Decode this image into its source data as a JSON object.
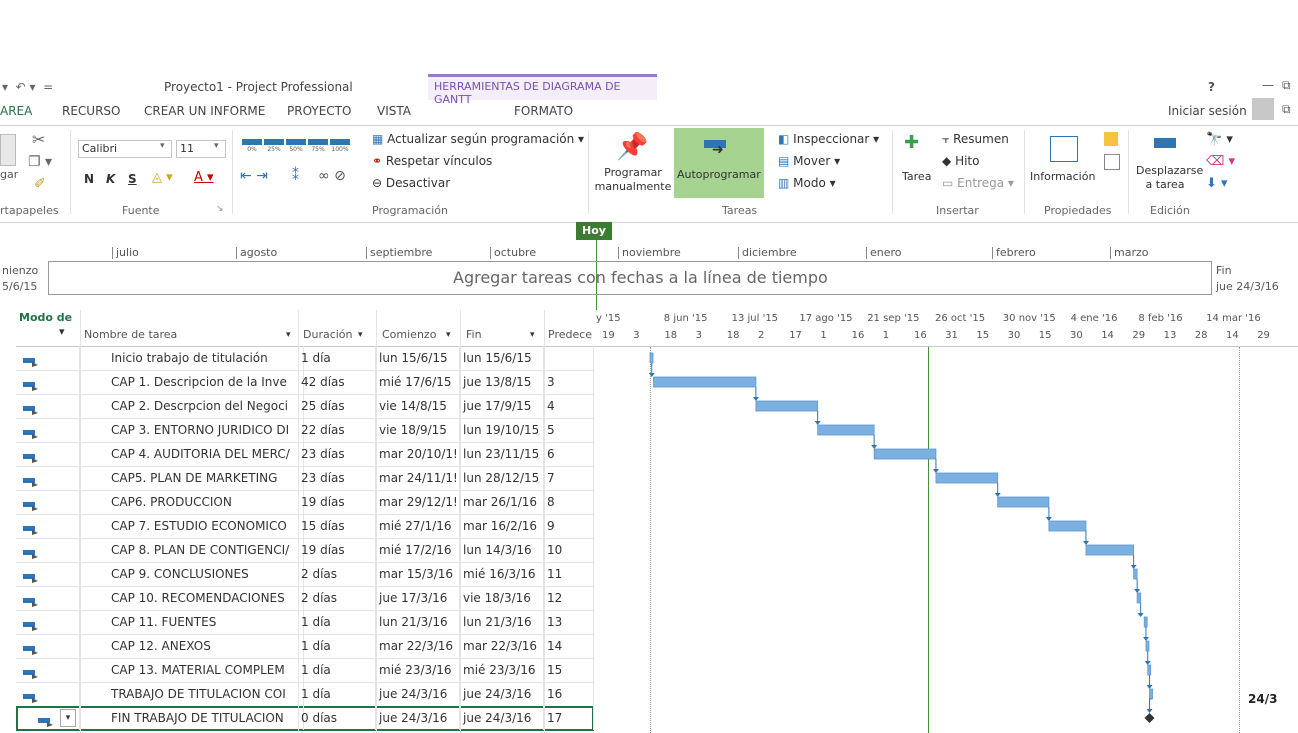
{
  "window": {
    "title": "Proyecto1 - Project Professional",
    "tool_context": "HERRAMIENTAS DE DIAGRAMA DE GANTT",
    "help": "?",
    "signin": "Iniciar sesión"
  },
  "tabs": [
    {
      "label": "AREA",
      "active": true
    },
    {
      "label": "RECURSO"
    },
    {
      "label": "CREAR UN INFORME"
    },
    {
      "label": "PROYECTO"
    },
    {
      "label": "VISTA"
    },
    {
      "label": "FORMATO"
    }
  ],
  "ribbon": {
    "clipboard": {
      "paste_label": "gar",
      "group": "rtapapeles"
    },
    "font": {
      "family": "Calibri",
      "size": "11",
      "bold": "N",
      "italic": "K",
      "underline": "S",
      "group": "Fuente"
    },
    "schedule": {
      "pct_labels": [
        "0%",
        "25%",
        "50%",
        "75%",
        "100%"
      ],
      "update": "Actualizar según programación",
      "respect": "Respetar vínculos",
      "deactivate": "Desactivar",
      "group": "Programación"
    },
    "tasks": {
      "manual": "Programar manualmente",
      "auto": "Autoprogramar",
      "inspect": "Inspeccionar",
      "move": "Mover",
      "mode": "Modo",
      "group": "Tareas"
    },
    "insert": {
      "task": "Tarea",
      "summary": "Resumen",
      "milestone": "Hito",
      "deliverable": "Entrega",
      "group": "Insertar"
    },
    "properties": {
      "info": "Información",
      "group": "Propiedades"
    },
    "editing": {
      "scroll": "Desplazarse a tarea",
      "group": "Edición"
    }
  },
  "timeline": {
    "today": "Hoy",
    "start_label": "nienzo",
    "start_date": "5/6/15",
    "end_label": "Fin",
    "end_date": "jue 24/3/16",
    "placeholder": "Agregar tareas con fechas a la línea de tiempo",
    "months": [
      "julio",
      "agosto",
      "septiembre",
      "octubre",
      "noviembre",
      "diciembre",
      "enero",
      "febrero",
      "marzo"
    ]
  },
  "table": {
    "headers": {
      "mode": "Modo de",
      "name": "Nombre de tarea",
      "duration": "Duración",
      "start": "Comienzo",
      "finish": "Fin",
      "pred": "Predece"
    },
    "rows": [
      {
        "name": "Inicio trabajo de titulación",
        "duration": "1 día",
        "start": "lun 15/6/15",
        "finish": "lun 15/6/15",
        "pred": ""
      },
      {
        "name": "CAP 1. Descripcion de la Inve",
        "duration": "42 días",
        "start": "mié 17/6/15",
        "finish": "jue 13/8/15",
        "pred": "3"
      },
      {
        "name": "CAP 2. Descrpcion del Negoci",
        "duration": "25 días",
        "start": "vie 14/8/15",
        "finish": "jue 17/9/15",
        "pred": "4"
      },
      {
        "name": "CAP 3. ENTORNO JURIDICO DI",
        "duration": "22 días",
        "start": "vie 18/9/15",
        "finish": "lun 19/10/15",
        "pred": "5"
      },
      {
        "name": "CAP 4. AUDITORIA DEL MERC/",
        "duration": "23 días",
        "start": "mar 20/10/1!",
        "finish": "lun 23/11/15",
        "pred": "6"
      },
      {
        "name": "CAP5. PLAN DE MARKETING",
        "duration": "23 días",
        "start": "mar 24/11/1!",
        "finish": "lun 28/12/15",
        "pred": "7"
      },
      {
        "name": "CAP6. PRODUCCION",
        "duration": "19 días",
        "start": "mar 29/12/1!",
        "finish": "mar 26/1/16",
        "pred": "8"
      },
      {
        "name": "CAP 7. ESTUDIO ECONOMICO",
        "duration": "15 días",
        "start": "mié 27/1/16",
        "finish": "mar 16/2/16",
        "pred": "9"
      },
      {
        "name": "CAP 8. PLAN DE CONTIGENCI/",
        "duration": "19 días",
        "start": "mié 17/2/16",
        "finish": "lun 14/3/16",
        "pred": "10"
      },
      {
        "name": "CAP 9. CONCLUSIONES",
        "duration": "2 días",
        "start": "mar 15/3/16",
        "finish": "mié 16/3/16",
        "pred": "11"
      },
      {
        "name": "CAP 10. RECOMENDACIONES",
        "duration": "2 días",
        "start": "jue 17/3/16",
        "finish": "vie 18/3/16",
        "pred": "12"
      },
      {
        "name": "CAP 11. FUENTES",
        "duration": "1 día",
        "start": "lun 21/3/16",
        "finish": "lun 21/3/16",
        "pred": "13"
      },
      {
        "name": "CAP 12. ANEXOS",
        "duration": "1 día",
        "start": "mar 22/3/16",
        "finish": "mar 22/3/16",
        "pred": "14"
      },
      {
        "name": "CAP 13. MATERIAL COMPLEM",
        "duration": "1 día",
        "start": "mié 23/3/16",
        "finish": "mié 23/3/16",
        "pred": "15"
      },
      {
        "name": "TRABAJO DE TITULACION COI",
        "duration": "1 día",
        "start": "jue 24/3/16",
        "finish": "jue 24/3/16",
        "pred": "16"
      },
      {
        "name": "FIN TRABAJO DE TITULACION",
        "duration": "0 días",
        "start": "jue 24/3/16",
        "finish": "jue 24/3/16",
        "pred": "17"
      }
    ]
  },
  "gantt": {
    "top_scale": [
      "y '15",
      "8 jun '15",
      "13 jul '15",
      "17 ago '15",
      "21 sep '15",
      "26 oct '15",
      "30 nov '15",
      "4 ene '16",
      "8 feb '16",
      "14 mar '16"
    ],
    "bottom_scale": [
      "19",
      "3",
      "18",
      "3",
      "18",
      "2",
      "17",
      "1",
      "16",
      "1",
      "16",
      "31",
      "15",
      "30",
      "15",
      "30",
      "14",
      "29",
      "13",
      "28",
      "14",
      "29"
    ],
    "milestone_label": "24/3",
    "colors": {
      "bar": "#7cb0e1",
      "link": "#2e75b6",
      "today": "#4a8f3e"
    }
  }
}
